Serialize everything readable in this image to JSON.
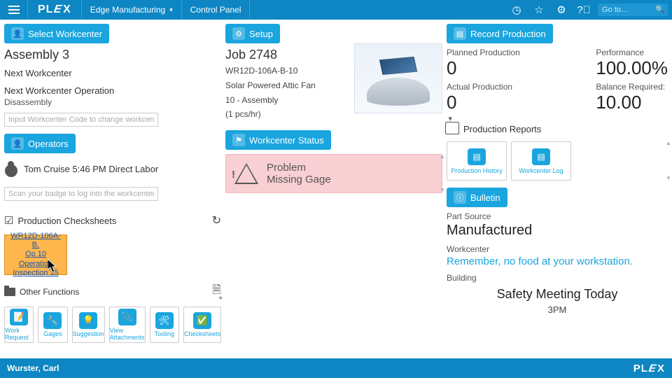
{
  "topbar": {
    "breadcrumb1": "Edge Manufacturing",
    "breadcrumb2": "Control Panel",
    "search_placeholder": "Go to..."
  },
  "workcenter": {
    "button": "Select Workcenter",
    "title": "Assembly 3",
    "next_wc_lbl": "Next Workcenter",
    "next_op_lbl": "Next Workcenter Operation",
    "next_op_val": "Disassembly",
    "input_placeholder": "Input Workcenter Code to change workcenters"
  },
  "operators": {
    "button": "Operators",
    "row": "Tom Cruise 5:46 PM Direct Labor",
    "scan_placeholder": "Scan your badge to log into the workcenter"
  },
  "checksheets": {
    "header": "Production Checksheets",
    "card_l1": "WR12D-106A-B,",
    "card_l2": "Op 10",
    "card_l3": "Operation",
    "card_l4": "Inspection 15"
  },
  "other_functions": {
    "header": "Other Functions",
    "items": [
      "Work Request",
      "Gages",
      "Suggestion",
      "View Attachments",
      "Tooling",
      "Checksheets"
    ]
  },
  "setup": {
    "button": "Setup",
    "job": "Job 2748",
    "part": "WR12D-106A-B-10",
    "desc": "Solar Powered Attic Fan",
    "op": "10 - Assembly",
    "rate": "(1 pcs/hr)"
  },
  "wc_status": {
    "button": "Workcenter Status",
    "line1": "Problem",
    "line2": "Missing Gage"
  },
  "production": {
    "button": "Record Production",
    "planned_lbl": "Planned Production",
    "planned_val": "0",
    "actual_lbl": "Actual Production",
    "actual_val": "0",
    "perf_lbl": "Performance",
    "perf_val": "100.00%",
    "balance_lbl": "Balance Required:",
    "balance_val": "10.00"
  },
  "reports": {
    "header": "Production Reports",
    "cards": [
      "Production History",
      "Workcenter Log"
    ]
  },
  "bulletin": {
    "button": "Bulletin",
    "ps_lbl": "Part Source",
    "ps_val": "Manufactured",
    "wc_lbl": "Workcenter",
    "wc_msg": "Remember, no food at your workstation.",
    "bld_lbl": "Building",
    "meeting_title": "Safety Meeting Today",
    "meeting_time": "3PM"
  },
  "footer": {
    "user": "Wurster, Carl"
  }
}
